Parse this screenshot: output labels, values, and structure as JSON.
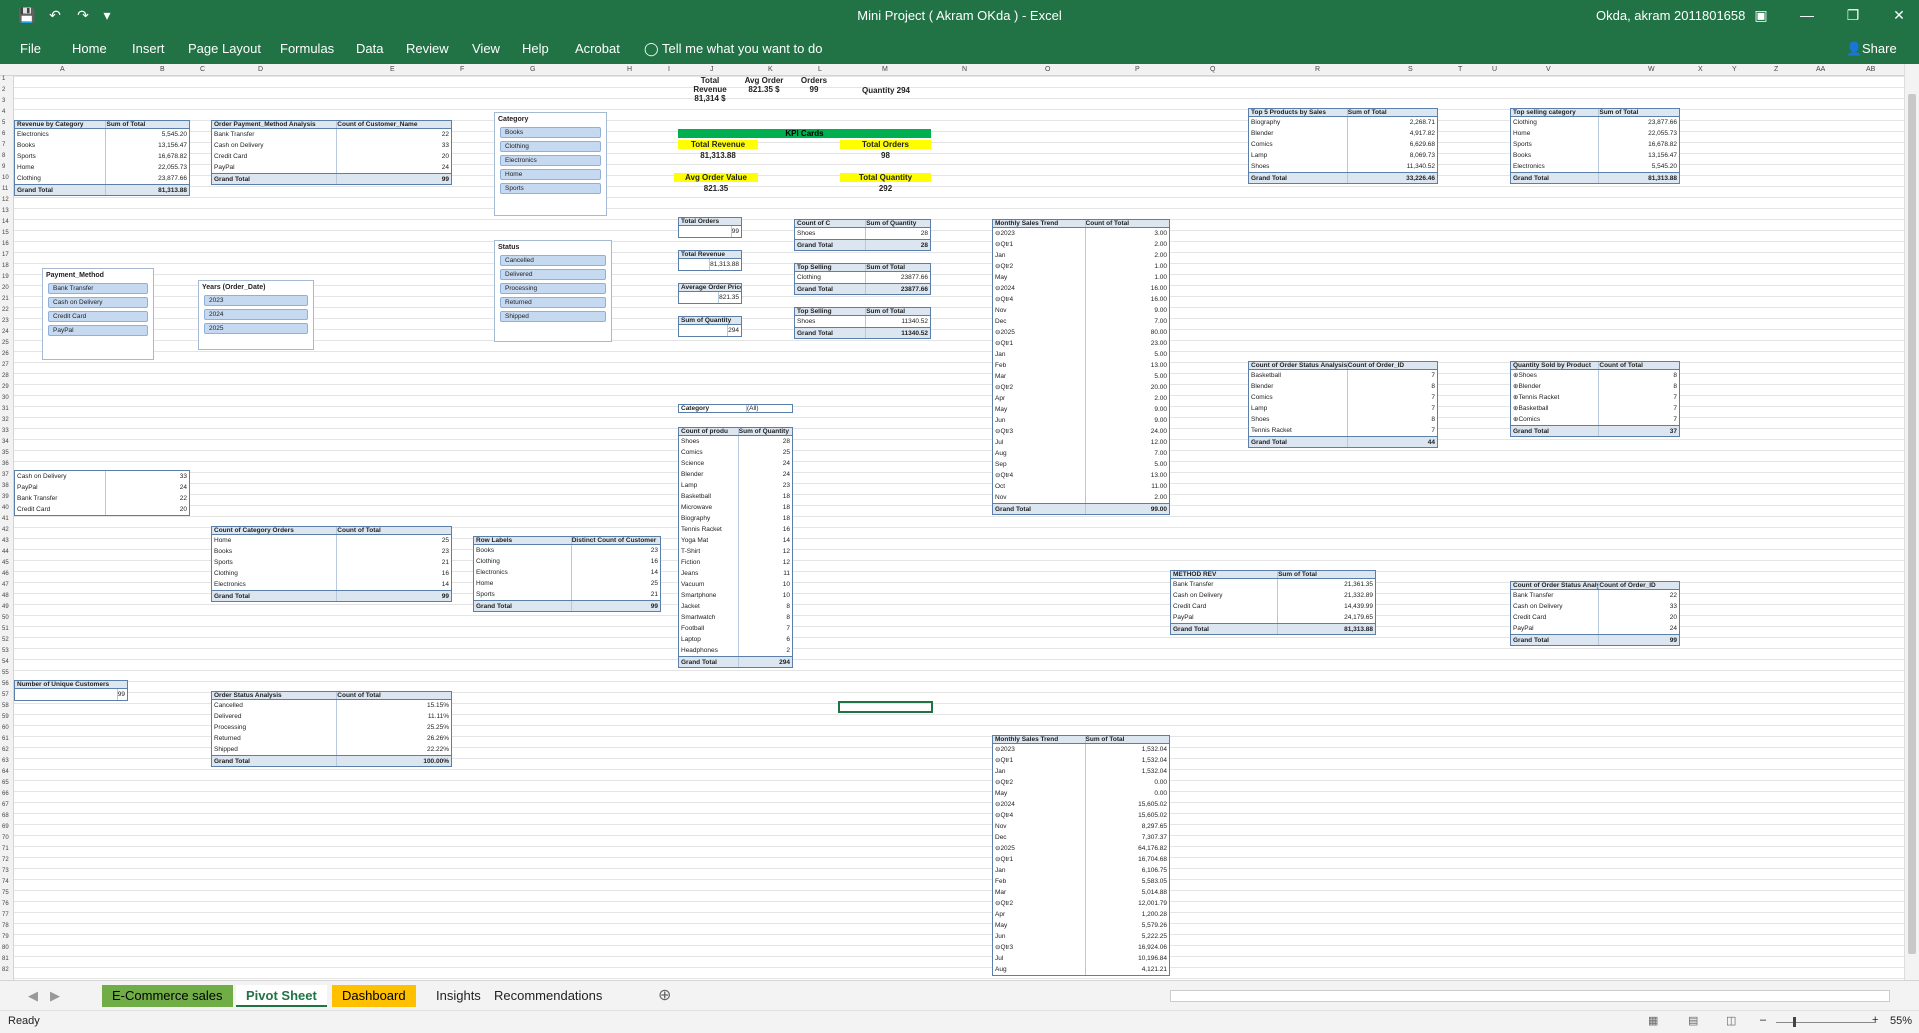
{
  "app": {
    "title": "Mini Project ( Akram OKda ) - Excel",
    "user": "Okda, akram 2011801658",
    "share": "Share"
  },
  "ribbon": {
    "tabs": [
      "File",
      "Home",
      "Insert",
      "Page Layout",
      "Formulas",
      "Data",
      "Review",
      "View",
      "Help",
      "Acrobat"
    ],
    "tell": "Tell me what you want to do"
  },
  "columns": [
    "A",
    "B",
    "C",
    "D",
    "E",
    "F",
    "G",
    "H",
    "I",
    "J",
    "K",
    "L",
    "M",
    "N",
    "O",
    "P",
    "Q",
    "R",
    "S",
    "T",
    "U",
    "V",
    "W",
    "X",
    "Y",
    "Z",
    "AA",
    "AB"
  ],
  "rev_by_cat": {
    "h1": "Revenue by Category",
    "h2": "Sum of Total",
    "rows": [
      [
        "Electronics",
        "5,545.20"
      ],
      [
        "Books",
        "13,156.47"
      ],
      [
        "Sports",
        "16,678.82"
      ],
      [
        "Home",
        "22,055.73"
      ],
      [
        "Clothing",
        "23,877.66"
      ]
    ],
    "total": [
      "Grand Total",
      "81,313.88"
    ]
  },
  "payment_cust": {
    "h1": "Order Payment_Method Analysis",
    "h2": "Count of Customer_Name",
    "rows": [
      [
        "Bank Transfer",
        "22"
      ],
      [
        "Cash on Delivery",
        "33"
      ],
      [
        "Credit Card",
        "20"
      ],
      [
        "PayPal",
        "24"
      ]
    ],
    "total": [
      "Grand Total",
      "99"
    ]
  },
  "slicer_category": {
    "title": "Category",
    "items": [
      "Books",
      "Clothing",
      "Electronics",
      "Home",
      "Sports"
    ]
  },
  "slicer_status": {
    "title": "Status",
    "items": [
      "Cancelled",
      "Delivered",
      "Processing",
      "Returned",
      "Shipped"
    ]
  },
  "slicer_payment": {
    "title": "Payment_Method",
    "items": [
      "Bank Transfer",
      "Cash on Delivery",
      "Credit Card",
      "PayPal"
    ]
  },
  "slicer_years": {
    "title": "Years (Order_Date)",
    "items": [
      "2023",
      "2024",
      "2025"
    ]
  },
  "kpi_top": {
    "rev_l": "Total Revenue",
    "rev_v": "81,314 $",
    "avg_l": "Avg Order",
    "avg_v": "821.35 $",
    "ord_l": "Orders",
    "ord_v": "99",
    "qty": "Quantity  294"
  },
  "kpi_cards": {
    "title": "KPI Cards",
    "tr_l": "Total Revenue",
    "tr_v": "81,313.88",
    "to_l": "Total Orders",
    "to_v": "98",
    "aov_l": "Avg Order Value",
    "aov_v": "821.35",
    "tq_l": "Total Quantity",
    "tq_v": "292"
  },
  "small": {
    "to_l": "Total Orders",
    "to_v": "99",
    "tr_l": "Total Revenue",
    "tr_v": "81,313.88",
    "ap_l": "Average Order Price",
    "ap_v": "821.35",
    "sq_l": "Sum of Quantity",
    "sq_v": "294"
  },
  "top_qty": {
    "h1": "Count of C",
    "h2": "Sum of Quantity",
    "rows": [
      [
        "Shoes",
        "28"
      ]
    ],
    "total": [
      "Grand Total",
      "28"
    ]
  },
  "top_sell1": {
    "h1": "Top Selling",
    "h2": "Sum of Total",
    "rows": [
      [
        "Clothing",
        "23877.66"
      ]
    ],
    "total": [
      "Grand Total",
      "23877.66"
    ]
  },
  "top_sell2": {
    "h1": "Top Selling",
    "h2": "Sum of Total",
    "rows": [
      [
        "Shoes",
        "11340.52"
      ]
    ],
    "total": [
      "Grand Total",
      "11340.52"
    ]
  },
  "cat_filter": {
    "label": "Category",
    "value": "(All)"
  },
  "prod_qty": {
    "h1": "Count of produ",
    "h2": "Sum of Quantity",
    "rows": [
      [
        "Shoes",
        "28"
      ],
      [
        "Comics",
        "25"
      ],
      [
        "Science",
        "24"
      ],
      [
        "Blender",
        "24"
      ],
      [
        "Lamp",
        "23"
      ],
      [
        "Basketball",
        "18"
      ],
      [
        "Microwave",
        "18"
      ],
      [
        "Biography",
        "18"
      ],
      [
        "Tennis Racket",
        "16"
      ],
      [
        "Yoga Mat",
        "14"
      ],
      [
        "T-Shirt",
        "12"
      ],
      [
        "Fiction",
        "12"
      ],
      [
        "Jeans",
        "11"
      ],
      [
        "Vacuum",
        "10"
      ],
      [
        "Smartphone",
        "10"
      ],
      [
        "Jacket",
        "8"
      ],
      [
        "Smartwatch",
        "8"
      ],
      [
        "Football",
        "7"
      ],
      [
        "Laptop",
        "6"
      ],
      [
        "Headphones",
        "2"
      ]
    ],
    "total": [
      "Grand Total",
      "294"
    ]
  },
  "monthly_count": {
    "h1": "Monthly Sales Trend",
    "h2": "Count of Total",
    "rows": [
      [
        "⊖2023",
        "3.00"
      ],
      [
        "⊖Qtr1",
        "2.00"
      ],
      [
        "Jan",
        "2.00"
      ],
      [
        "⊖Qtr2",
        "1.00"
      ],
      [
        "May",
        "1.00"
      ],
      [
        "⊖2024",
        "16.00"
      ],
      [
        "⊖Qtr4",
        "16.00"
      ],
      [
        "Nov",
        "9.00"
      ],
      [
        "Dec",
        "7.00"
      ],
      [
        "⊖2025",
        "80.00"
      ],
      [
        "⊖Qtr1",
        "23.00"
      ],
      [
        "Jan",
        "5.00"
      ],
      [
        "Feb",
        "13.00"
      ],
      [
        "Mar",
        "5.00"
      ],
      [
        "⊖Qtr2",
        "20.00"
      ],
      [
        "Apr",
        "2.00"
      ],
      [
        "May",
        "9.00"
      ],
      [
        "Jun",
        "9.00"
      ],
      [
        "⊖Qtr3",
        "24.00"
      ],
      [
        "Jul",
        "12.00"
      ],
      [
        "Aug",
        "7.00"
      ],
      [
        "Sep",
        "5.00"
      ],
      [
        "⊖Qtr4",
        "13.00"
      ],
      [
        "Oct",
        "11.00"
      ],
      [
        "Nov",
        "2.00"
      ]
    ],
    "total": [
      "Grand Total",
      "99.00"
    ]
  },
  "top5": {
    "h1": "Top 5 Products by Sales",
    "h2": "Sum of Total",
    "rows": [
      [
        "Biography",
        "2,268.71"
      ],
      [
        "Blender",
        "4,917.82"
      ],
      [
        "Comics",
        "6,629.68"
      ],
      [
        "Lamp",
        "8,069.73"
      ],
      [
        "Shoes",
        "11,340.52"
      ]
    ],
    "total": [
      "Grand Total",
      "33,226.46"
    ]
  },
  "top_cat": {
    "h1": "Top selling category",
    "h2": "Sum of Total",
    "rows": [
      [
        "Clothing",
        "23,877.66"
      ],
      [
        "Home",
        "22,055.73"
      ],
      [
        "Sports",
        "16,678.82"
      ],
      [
        "Books",
        "13,156.47"
      ],
      [
        "Electronics",
        "5,545.20"
      ]
    ],
    "total": [
      "Grand Total",
      "81,313.88"
    ]
  },
  "status_prod": {
    "h1": "Count of Order Status Analysis",
    "h2": "Count of Order_ID",
    "rows": [
      [
        "Basketball",
        "7"
      ],
      [
        "Blender",
        "8"
      ],
      [
        "Comics",
        "7"
      ],
      [
        "Lamp",
        "7"
      ],
      [
        "Shoes",
        "8"
      ],
      [
        "Tennis Racket",
        "7"
      ]
    ],
    "total": [
      "Grand Total",
      "44"
    ]
  },
  "qty_prod": {
    "h1": "Quantity Sold by Product",
    "h2": "Count of Total",
    "rows": [
      [
        "⊕Shoes",
        "8"
      ],
      [
        "⊕Blender",
        "8"
      ],
      [
        "⊕Tennis Racket",
        "7"
      ],
      [
        "⊕Basketball",
        "7"
      ],
      [
        "⊕Comics",
        "7"
      ]
    ],
    "total": [
      "Grand Total",
      "37"
    ]
  },
  "pay_list": {
    "rows": [
      [
        "Cash on Delivery",
        "33"
      ],
      [
        "PayPal",
        "24"
      ],
      [
        "Bank Transfer",
        "22"
      ],
      [
        "Credit Card",
        "20"
      ]
    ]
  },
  "cat_orders": {
    "h1": "Count of Category Orders",
    "h2": "Count of Total",
    "rows": [
      [
        "Home",
        "25"
      ],
      [
        "Books",
        "23"
      ],
      [
        "Sports",
        "21"
      ],
      [
        "Clothing",
        "16"
      ],
      [
        "Electronics",
        "14"
      ]
    ],
    "total": [
      "Grand Total",
      "99"
    ]
  },
  "distinct": {
    "h1": "Row Labels",
    "h2": "Distinct Count of Customer",
    "rows": [
      [
        "Books",
        "23"
      ],
      [
        "Clothing",
        "16"
      ],
      [
        "Electronics",
        "14"
      ],
      [
        "Home",
        "25"
      ],
      [
        "Sports",
        "21"
      ]
    ],
    "total": [
      "Grand Total",
      "99"
    ]
  },
  "method_rev": {
    "h1": "METHOD REV",
    "h2": "Sum of Total",
    "rows": [
      [
        "Bank Transfer",
        "21,361.35"
      ],
      [
        "Cash on Delivery",
        "21,332.89"
      ],
      [
        "Credit Card",
        "14,439.99"
      ],
      [
        "PayPal",
        "24,179.65"
      ]
    ],
    "total": [
      "Grand Total",
      "81,313.88"
    ]
  },
  "status_pay": {
    "h1": "Count of Order Status Analysis",
    "h2": "Count of Order_ID",
    "rows": [
      [
        "Bank Transfer",
        "22"
      ],
      [
        "Cash on Delivery",
        "33"
      ],
      [
        "Credit Card",
        "20"
      ],
      [
        "PayPal",
        "24"
      ]
    ],
    "total": [
      "Grand Total",
      "99"
    ]
  },
  "unique": {
    "h1": "Number of Unique Customers",
    "v": "99"
  },
  "status_pct": {
    "h1": "Order Status Analysis",
    "h2": "Count of Total",
    "rows": [
      [
        "Cancelled",
        "15.15%"
      ],
      [
        "Delivered",
        "11.11%"
      ],
      [
        "Processing",
        "25.25%"
      ],
      [
        "Returned",
        "26.26%"
      ],
      [
        "Shipped",
        "22.22%"
      ]
    ],
    "total": [
      "Grand Total",
      "100.00%"
    ]
  },
  "monthly_sum": {
    "h1": "Monthly Sales Trend",
    "h2": "Sum of Total",
    "rows": [
      [
        "⊖2023",
        "1,532.04"
      ],
      [
        "⊖Qtr1",
        "1,532.04"
      ],
      [
        "Jan",
        "1,532.04"
      ],
      [
        "⊖Qtr2",
        "0.00"
      ],
      [
        "May",
        "0.00"
      ],
      [
        "⊖2024",
        "15,605.02"
      ],
      [
        "⊖Qtr4",
        "15,605.02"
      ],
      [
        "Nov",
        "8,297.65"
      ],
      [
        "Dec",
        "7,307.37"
      ],
      [
        "⊖2025",
        "64,176.82"
      ],
      [
        "⊖Qtr1",
        "16,704.68"
      ],
      [
        "Jan",
        "6,106.75"
      ],
      [
        "Feb",
        "5,583.05"
      ],
      [
        "Mar",
        "5,014.88"
      ],
      [
        "⊖Qtr2",
        "12,001.79"
      ],
      [
        "Apr",
        "1,200.28"
      ],
      [
        "May",
        "5,579.26"
      ],
      [
        "Jun",
        "5,222.25"
      ],
      [
        "⊖Qtr3",
        "16,924.06"
      ],
      [
        "Jul",
        "10,196.84"
      ],
      [
        "Aug",
        "4,121.21"
      ]
    ]
  },
  "sheets": [
    "E-Commerce sales",
    "Pivot Sheet",
    "Dashboard",
    "Insights",
    "Recommendations"
  ],
  "status": {
    "ready": "Ready",
    "zoom": "55%"
  }
}
